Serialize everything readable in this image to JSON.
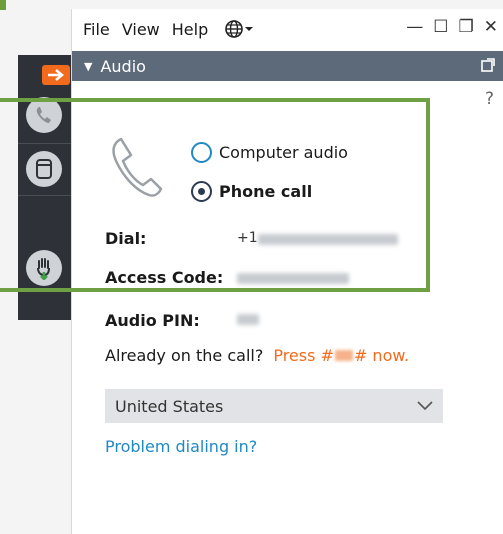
{
  "menu": {
    "items": [
      "File",
      "View",
      "Help"
    ]
  },
  "panel": {
    "title": "Audio",
    "help": "?"
  },
  "audio_options": {
    "computer": "Computer audio",
    "phone": "Phone call",
    "selected": "phone"
  },
  "fields": {
    "dial_label": "Dial:",
    "dial_prefix": "+1",
    "access_label": "Access Code:",
    "pin_label": "Audio PIN:"
  },
  "already": {
    "text": "Already on the call?",
    "press_prefix": "Press #",
    "press_suffix": "# now."
  },
  "country": {
    "value": "United States"
  },
  "problem_link": "Problem dialing in?",
  "colors": {
    "accent": "#f26b1d",
    "header": "#5d6a7a",
    "link": "#1f8ac2",
    "highlight": "#6ea144",
    "toolbar": "#2e3238"
  }
}
